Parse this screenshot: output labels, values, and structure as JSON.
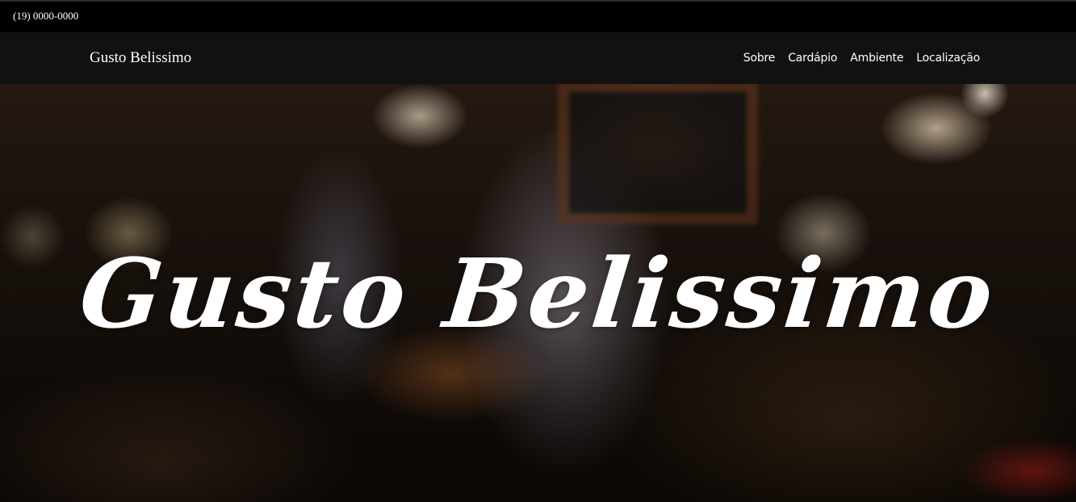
{
  "topbar": {
    "phone": "(19) 0000-0000"
  },
  "navbar": {
    "brand": "Gusto Belissimo",
    "links": [
      "Sobre",
      "Cardápio",
      "Ambiente",
      "Localização"
    ]
  },
  "hero": {
    "title": "Gusto Belissimo"
  },
  "colors": {
    "topbar_bg": "#000000",
    "navbar_bg": "#111111",
    "text": "#ffffff"
  }
}
